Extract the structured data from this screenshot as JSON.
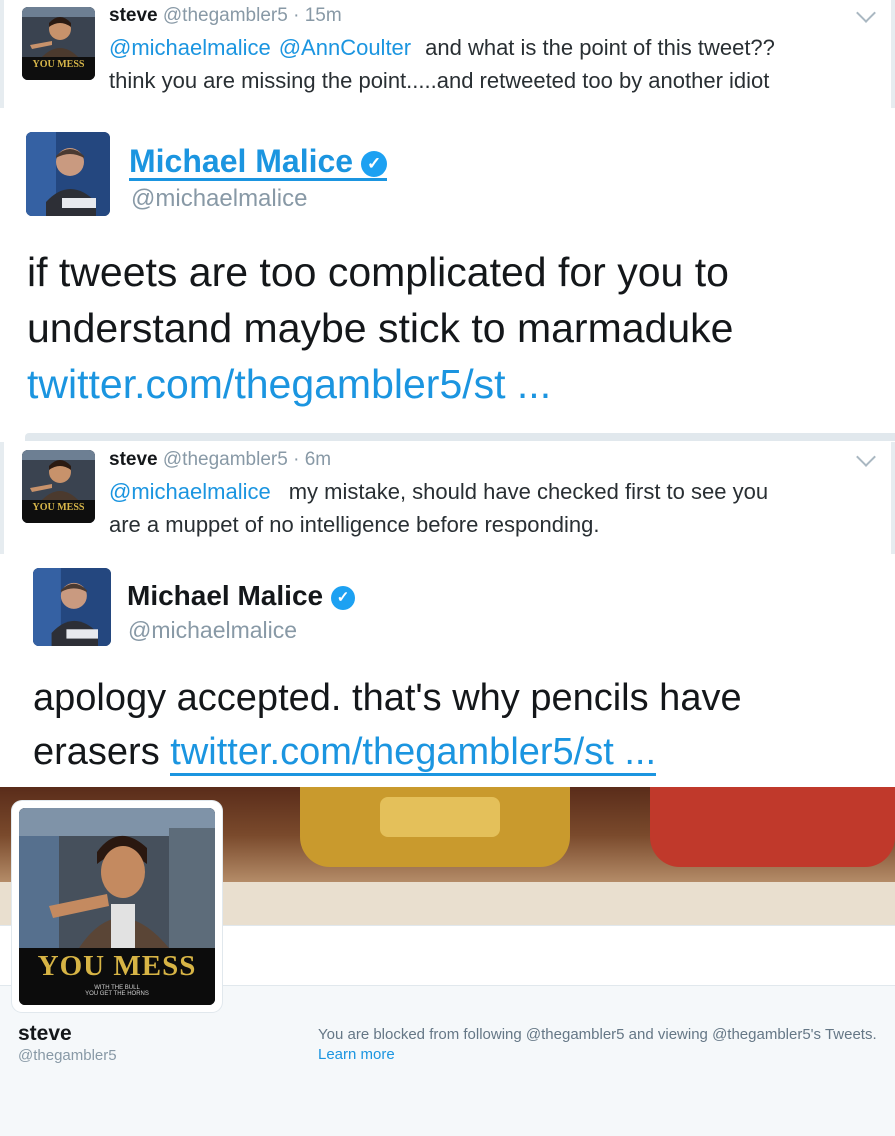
{
  "tweets": [
    {
      "name": "steve",
      "handle": "@thegambler5",
      "dot": "·",
      "time": "15m",
      "mentions": [
        "@michaelmalice",
        "@AnnCoulter"
      ],
      "text_line1": "and what is the point of this tweet??",
      "text_line2": "think you are missing the point.....and retweeted too by another idiot"
    },
    {
      "name": "steve",
      "handle": "@thegambler5",
      "dot": "·",
      "time": "6m",
      "mentions": [
        "@michaelmalice"
      ],
      "text_line1": "my mistake, should have checked first to see you",
      "text_line2": "are a muppet of no intelligence before responding."
    }
  ],
  "replies": [
    {
      "name": "Michael Malice",
      "handle": "@michaelmalice",
      "line1": "if tweets are too complicated for you to",
      "line2": "understand maybe stick to marmaduke",
      "link": "twitter.com/thegambler5/st ..."
    },
    {
      "name": "Michael Malice",
      "handle": "@michaelmalice",
      "line1": "apology accepted. that's why pencils have",
      "line2_prefix": "erasers",
      "link": "twitter.com/thegambler5/st ..."
    }
  ],
  "avatar_caption": {
    "title": "YOU MESS",
    "sub1": "WITH THE BULL",
    "sub2": "YOU GET THE HORNS"
  },
  "profile": {
    "name": "steve",
    "handle": "@thegambler5",
    "blocked_text": "You are blocked from following @thegambler5 and viewing @thegambler5's Tweets.",
    "learn_more": "Learn more"
  },
  "colors": {
    "link": "#1b95e0",
    "verified": "#1da1f2",
    "muted": "#8899a6"
  }
}
